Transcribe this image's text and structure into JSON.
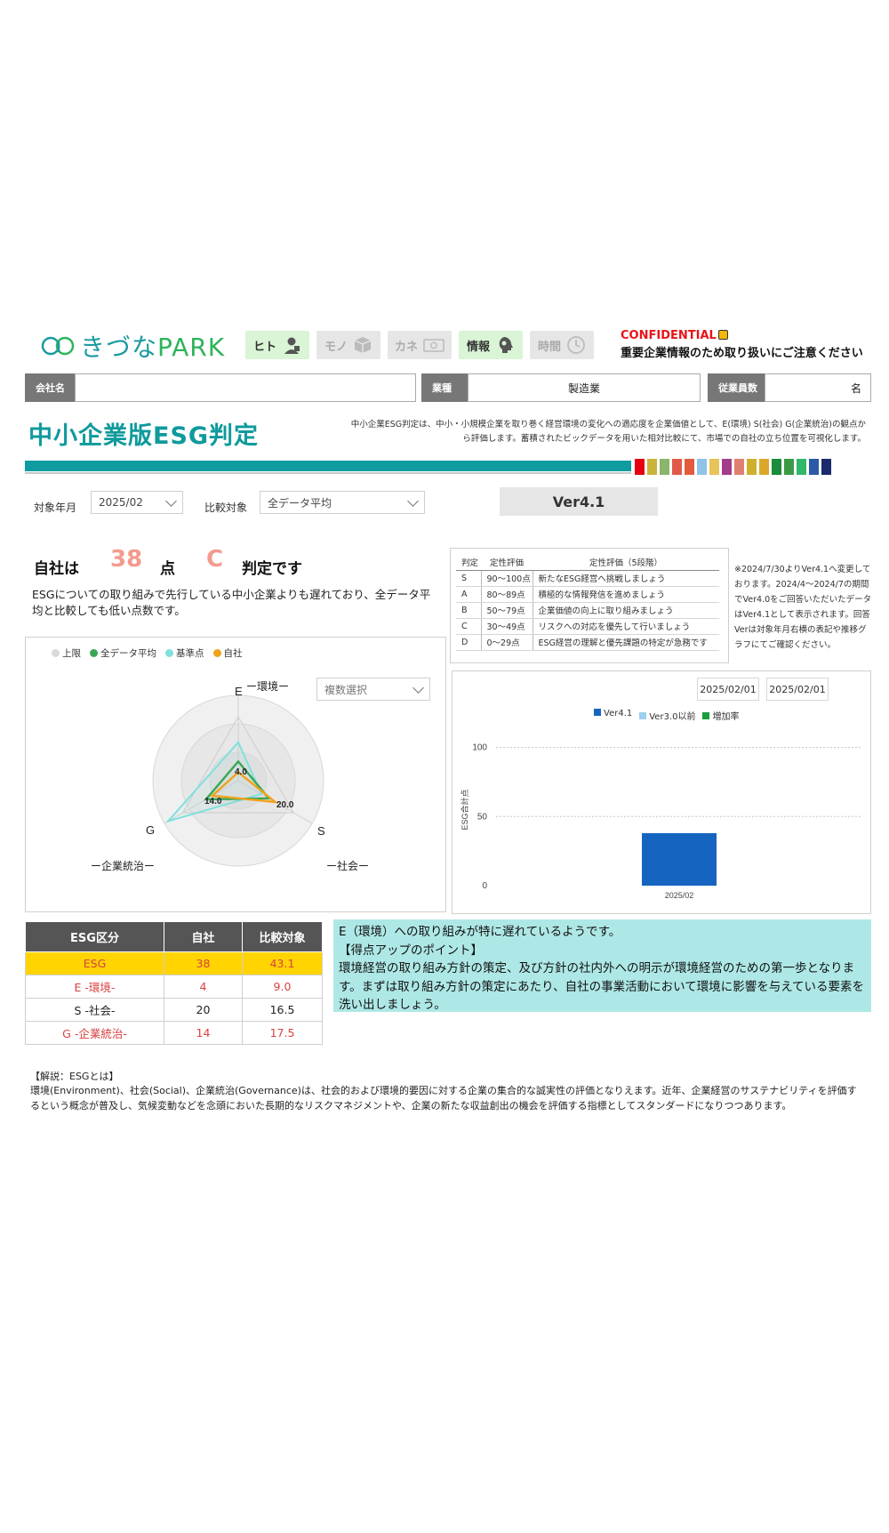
{
  "header": {
    "logo_main": "きづな",
    "logo_accent": "PARK",
    "nav": [
      {
        "label": "ヒト",
        "icon": "person-icon",
        "active": true
      },
      {
        "label": "モノ",
        "icon": "box-icon",
        "active": false
      },
      {
        "label": "カネ",
        "icon": "money-icon",
        "active": false
      },
      {
        "label": "情報",
        "icon": "brain-icon",
        "active": true
      },
      {
        "label": "時間",
        "icon": "clock-icon",
        "active": false
      }
    ],
    "confidential": "CONFIDENTIAL",
    "confidential_note": "重要企業情報のため取り扱いにご注意ください"
  },
  "info": {
    "company_label": "会社名",
    "company_value": "",
    "industry_label": "業種",
    "industry_value": "製造業",
    "employees_label": "従業員数",
    "employees_unit": "名"
  },
  "title": "中小企業版ESG判定",
  "description": "中小企業ESG判定は、中小・小規模企業を取り巻く経営環境の変化への適応度を企業価値として、E(環境) S(社会) G(企業統治)の観点から評価します。蓄積されたビックデータを用いた相対比較にて、市場での自社の立ち位置を可視化します。",
  "colors": {
    "teal": "#0e9ca0",
    "score_red": "#f49a8e",
    "highlight": "#ffd400",
    "swatches": [
      "#e60012",
      "#c9b33a",
      "#8ab56b",
      "#e05a4c",
      "#e45a3d",
      "#8fc3e8",
      "#e8c25a",
      "#a23c8c",
      "#e08070",
      "#cfb02e",
      "#d9a72a",
      "#1a8c3c",
      "#3c9a46",
      "#2fb86a",
      "#2c5aa8",
      "#1a2a6c"
    ]
  },
  "filters": {
    "month_label": "対象年月",
    "month_value": "2025/02",
    "compare_label": "比較対象",
    "compare_value": "全データ平均",
    "version": "Ver4.1"
  },
  "score": {
    "prefix": "自社は",
    "value": "38",
    "unit": "点",
    "grade": "C",
    "suffix": "判定です",
    "summary": "ESGについての取り組みで先行している中小企業よりも遅れており、全データ平均と比較しても低い点数です。"
  },
  "rank_table": {
    "headers": [
      "判定",
      "定性評価",
      "定性評価（5段階）"
    ],
    "rows": [
      [
        "S",
        "90～100点",
        "新たなESG経営へ挑戦しましょう"
      ],
      [
        "A",
        "80～89点",
        "積極的な情報発信を進めましょう"
      ],
      [
        "B",
        "50～79点",
        "企業価値の向上に取り組みましょう"
      ],
      [
        "C",
        "30～49点",
        "リスクへの対応を優先して行いましょう"
      ],
      [
        "D",
        "0～29点",
        "ESG経営の理解と優先課題の特定が急務です"
      ]
    ]
  },
  "note": "※2024/7/30よりVer4.1へ変更しております。2024/4～2024/7の期間でVer4.0をご回答いただいたデータはVer4.1として表示されます。回答Verは対象年月右横の表記や推移グラフにてご確認ください。",
  "radar": {
    "legend": [
      {
        "label": "上限",
        "color": "#d9d9d9"
      },
      {
        "label": "全データ平均",
        "color": "#3aa655"
      },
      {
        "label": "基準点",
        "color": "#7fe0dd"
      },
      {
        "label": "自社",
        "color": "#f0a21a"
      }
    ],
    "multi_select": "複数選択",
    "axis_letters": {
      "E": "E",
      "S": "S",
      "G": "G"
    },
    "axis_names": {
      "E": "ー環境ー",
      "S": "ー社会ー",
      "G": "ー企業統治ー"
    },
    "value_labels": {
      "E": "4.0",
      "S": "20.0",
      "G": "14.0"
    }
  },
  "chart_data": {
    "type": "bar",
    "categories": [
      "2025/02"
    ],
    "series": [
      {
        "name": "Ver4.1",
        "color": "#1565c0",
        "values": [
          38
        ]
      },
      {
        "name": "Ver3.0以前",
        "color": "#9ecff0",
        "values": [
          0
        ]
      },
      {
        "name": "増加率",
        "color": "#1a9e3c",
        "values": [
          0
        ]
      }
    ],
    "ylabel": "ESG合計点",
    "yticks": [
      0,
      50,
      100
    ],
    "ylim": [
      0,
      110
    ],
    "date_from": "2025/02/01",
    "date_to": "2025/02/01"
  },
  "esg_table": {
    "headers": [
      "ESG区分",
      "自社",
      "比較対象"
    ],
    "rows": [
      [
        "ESG",
        "38",
        "43.1"
      ],
      [
        "E -環境-",
        "4",
        "9.0"
      ],
      [
        "S -社会-",
        "20",
        "16.5"
      ],
      [
        "G -企業統治-",
        "14",
        "17.5"
      ]
    ]
  },
  "advice": {
    "line1": "E（環境）への取り組みが特に遅れているようです。",
    "line2": "【得点アップのポイント】",
    "line3": "環境経営の取り組み方針の策定、及び方針の社内外への明示が環境経営のための第一歩となります。まずは取り組み方針の策定にあたり、自社の事業活動において環境に影響を与えている要素を洗い出しましょう。"
  },
  "explanation": {
    "title": "【解説：ESGとは】",
    "body": "環境(Environment)、社会(Social)、企業統治(Governance)は、社会的および環境的要因に対する企業の集合的な誠実性の評価となりえます。近年、企業経営のサステナビリティを評価するという概念が普及し、気候変動などを念頭においた長期的なリスクマネジメントや、企業の新たな収益創出の機会を評価する指標としてスタンダードになりつつあります。"
  }
}
